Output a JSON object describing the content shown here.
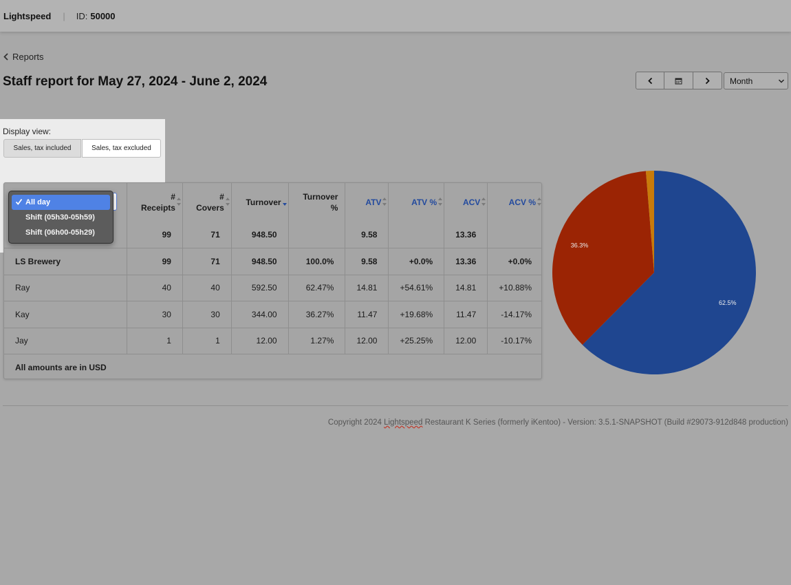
{
  "header": {
    "brand": "Lightspeed",
    "separator": "|",
    "id_label": "ID:",
    "id_value": "50000"
  },
  "breadcrumb": {
    "back_label": "Reports"
  },
  "page": {
    "title": "Staff report for May 27, 2024 - June 2, 2024"
  },
  "date_controls": {
    "period_select": "Month"
  },
  "display_view": {
    "label": "Display view:",
    "options": [
      "Sales, tax included",
      "Sales, tax excluded"
    ],
    "selected": "Sales, tax included"
  },
  "shift_dropdown": {
    "options": [
      "All day",
      "Shift (05h30-05h59)",
      "Shift (06h00-05h29)"
    ],
    "selected": "All day"
  },
  "table": {
    "headers": [
      "# Receipts",
      "# Covers",
      "Turnover",
      "Turnover %",
      "ATV",
      "ATV %",
      "ACV",
      "ACV %"
    ],
    "headers_lines": [
      [
        "#",
        "Receipts"
      ],
      [
        "#",
        "Covers"
      ],
      [
        "Turnover"
      ],
      [
        "Turnover",
        "%"
      ],
      [
        "ATV"
      ],
      [
        "ATV %"
      ],
      [
        "ACV"
      ],
      [
        "ACV %"
      ]
    ],
    "total_row": [
      "",
      "99",
      "71",
      "948.50",
      "",
      "9.58",
      "",
      "13.36",
      ""
    ],
    "rows": [
      [
        "LS Brewery",
        "99",
        "71",
        "948.50",
        "100.0%",
        "9.58",
        "+0.0%",
        "13.36",
        "+0.0%"
      ],
      [
        "Ray",
        "40",
        "40",
        "592.50",
        "62.47%",
        "14.81",
        "+54.61%",
        "14.81",
        "+10.88%"
      ],
      [
        "Kay",
        "30",
        "30",
        "344.00",
        "36.27%",
        "11.47",
        "+19.68%",
        "11.47",
        "-14.17%"
      ],
      [
        "Jay",
        "1",
        "1",
        "12.00",
        "1.27%",
        "12.00",
        "+25.25%",
        "12.00",
        "-10.17%"
      ]
    ],
    "footnote": "All amounts are in USD"
  },
  "chart_data": {
    "type": "pie",
    "categories": [
      "Ray",
      "Kay",
      "Jay"
    ],
    "values": [
      62.5,
      36.3,
      1.3
    ],
    "labels": [
      "62.5%",
      "36.3%",
      ""
    ],
    "colors": [
      "#1f4690",
      "#9b2404",
      "#c87b0b"
    ]
  },
  "footer": {
    "copyright_prefix": "Copyright 2024 ",
    "copyright_brand": "Lightspeed",
    "copyright_suffix": " Restaurant K Series (formerly iKentoo) - Version: 3.5.1-SNAPSHOT (Build #29073-912d848 production)"
  }
}
